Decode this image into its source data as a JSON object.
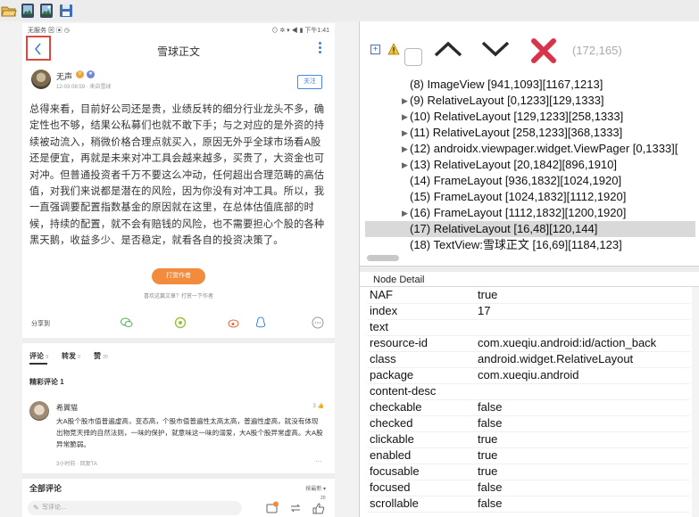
{
  "device": {
    "status_left": "无服务 ⊠ ▣ ◷",
    "status_right": "⊙ ✲ ▾ ◀ ▮ 下午1:41",
    "title": "雪球正文",
    "author": {
      "name": "无声",
      "meta": "12-03 08:59 · 来自雪球",
      "follow": "关注"
    },
    "article": "总得来看，目前好公司还是贵，业绩反转的细分行业龙头不多，确定性也不够，结果公私募们也就不敢下手；与之对应的是外资的持续被动流入，稍微价格合理点就买入，原因无外乎全球市场看A股还是便宜，再就是未来对冲工具会越来越多，买贵了，大资金也可对冲。但普通投资者千万不要这么冲动，任何超出合理范畴的高估值，对我们来说都是潜在的风险，因为你没有对冲工具。所以，我一直强调要配置指数基金的原因就在这里，在总体估值底部的时候，持续的配置，就不会有赔钱的风险，也不需要担心个股的各种黑天鹅，收益多少、是否稳定，就看各自的投资决策了。",
    "reward_button": "打赏作者",
    "reward_hint": "喜欢这篇文章？打赏一下作者",
    "share_label": "分享到",
    "tabs": [
      {
        "label": "评论",
        "count": "9"
      },
      {
        "label": "转发",
        "count": "0"
      },
      {
        "label": "赞",
        "count": "20"
      }
    ],
    "featured_title": "精彩评论 1",
    "comment": {
      "name": "希翼猫",
      "likes": "3",
      "text": "大A股个股市值普遍虚高，变态高，个股市值普遍性太高太高，普遍性虚高，就没有体现出物竞天择的自然法则，一味的保护，就意味这一味的溺爱，大A股个股异常虚高。大A股异常脆弱。",
      "meta": "3小时前 · 回复TA"
    },
    "all_comments": "全部评论",
    "sort_label": "按最新 ▾",
    "write_placeholder": "写评论...",
    "comment_badge": "9",
    "like_badge": "20"
  },
  "tree_toolbar": {
    "coords": "(172,165)"
  },
  "tree": [
    {
      "text": "(8) ImageView [941,1093][1167,1213]",
      "expandable": false,
      "selected": false
    },
    {
      "text": "(9) RelativeLayout [0,1233][129,1333]",
      "expandable": true,
      "selected": false
    },
    {
      "text": "(10) RelativeLayout [129,1233][258,1333]",
      "expandable": true,
      "selected": false
    },
    {
      "text": "(11) RelativeLayout [258,1233][368,1333]",
      "expandable": true,
      "selected": false
    },
    {
      "text": "(12) androidx.viewpager.widget.ViewPager [0,1333][",
      "expandable": true,
      "selected": false
    },
    {
      "text": "(13) RelativeLayout [20,1842][896,1910]",
      "expandable": true,
      "selected": false
    },
    {
      "text": "(14) FrameLayout [936,1832][1024,1920]",
      "expandable": false,
      "selected": false
    },
    {
      "text": "(15) FrameLayout [1024,1832][1112,1920]",
      "expandable": false,
      "selected": false
    },
    {
      "text": "(16) FrameLayout [1112,1832][1200,1920]",
      "expandable": true,
      "selected": false
    },
    {
      "text": "(17) RelativeLayout [16,48][120,144]",
      "expandable": false,
      "selected": true
    },
    {
      "text": "(18) TextView:雪球正文 [16,69][1184,123]",
      "expandable": false,
      "selected": false
    }
  ],
  "detail": {
    "title": "Node Detail",
    "rows": [
      {
        "key": "NAF",
        "value": "true"
      },
      {
        "key": "index",
        "value": "17"
      },
      {
        "key": "text",
        "value": ""
      },
      {
        "key": "resource-id",
        "value": "com.xueqiu.android:id/action_back"
      },
      {
        "key": "class",
        "value": "android.widget.RelativeLayout"
      },
      {
        "key": "package",
        "value": "com.xueqiu.android"
      },
      {
        "key": "content-desc",
        "value": ""
      },
      {
        "key": "checkable",
        "value": "false"
      },
      {
        "key": "checked",
        "value": "false"
      },
      {
        "key": "clickable",
        "value": "true"
      },
      {
        "key": "enabled",
        "value": "true"
      },
      {
        "key": "focusable",
        "value": "true"
      },
      {
        "key": "focused",
        "value": "false"
      },
      {
        "key": "scrollable",
        "value": "false"
      }
    ]
  },
  "colors": {
    "accent_red": "#e0483d",
    "link_blue": "#4a87e0",
    "reward_orange": "#f28b3c",
    "selected_row": "#d9d9d9"
  }
}
